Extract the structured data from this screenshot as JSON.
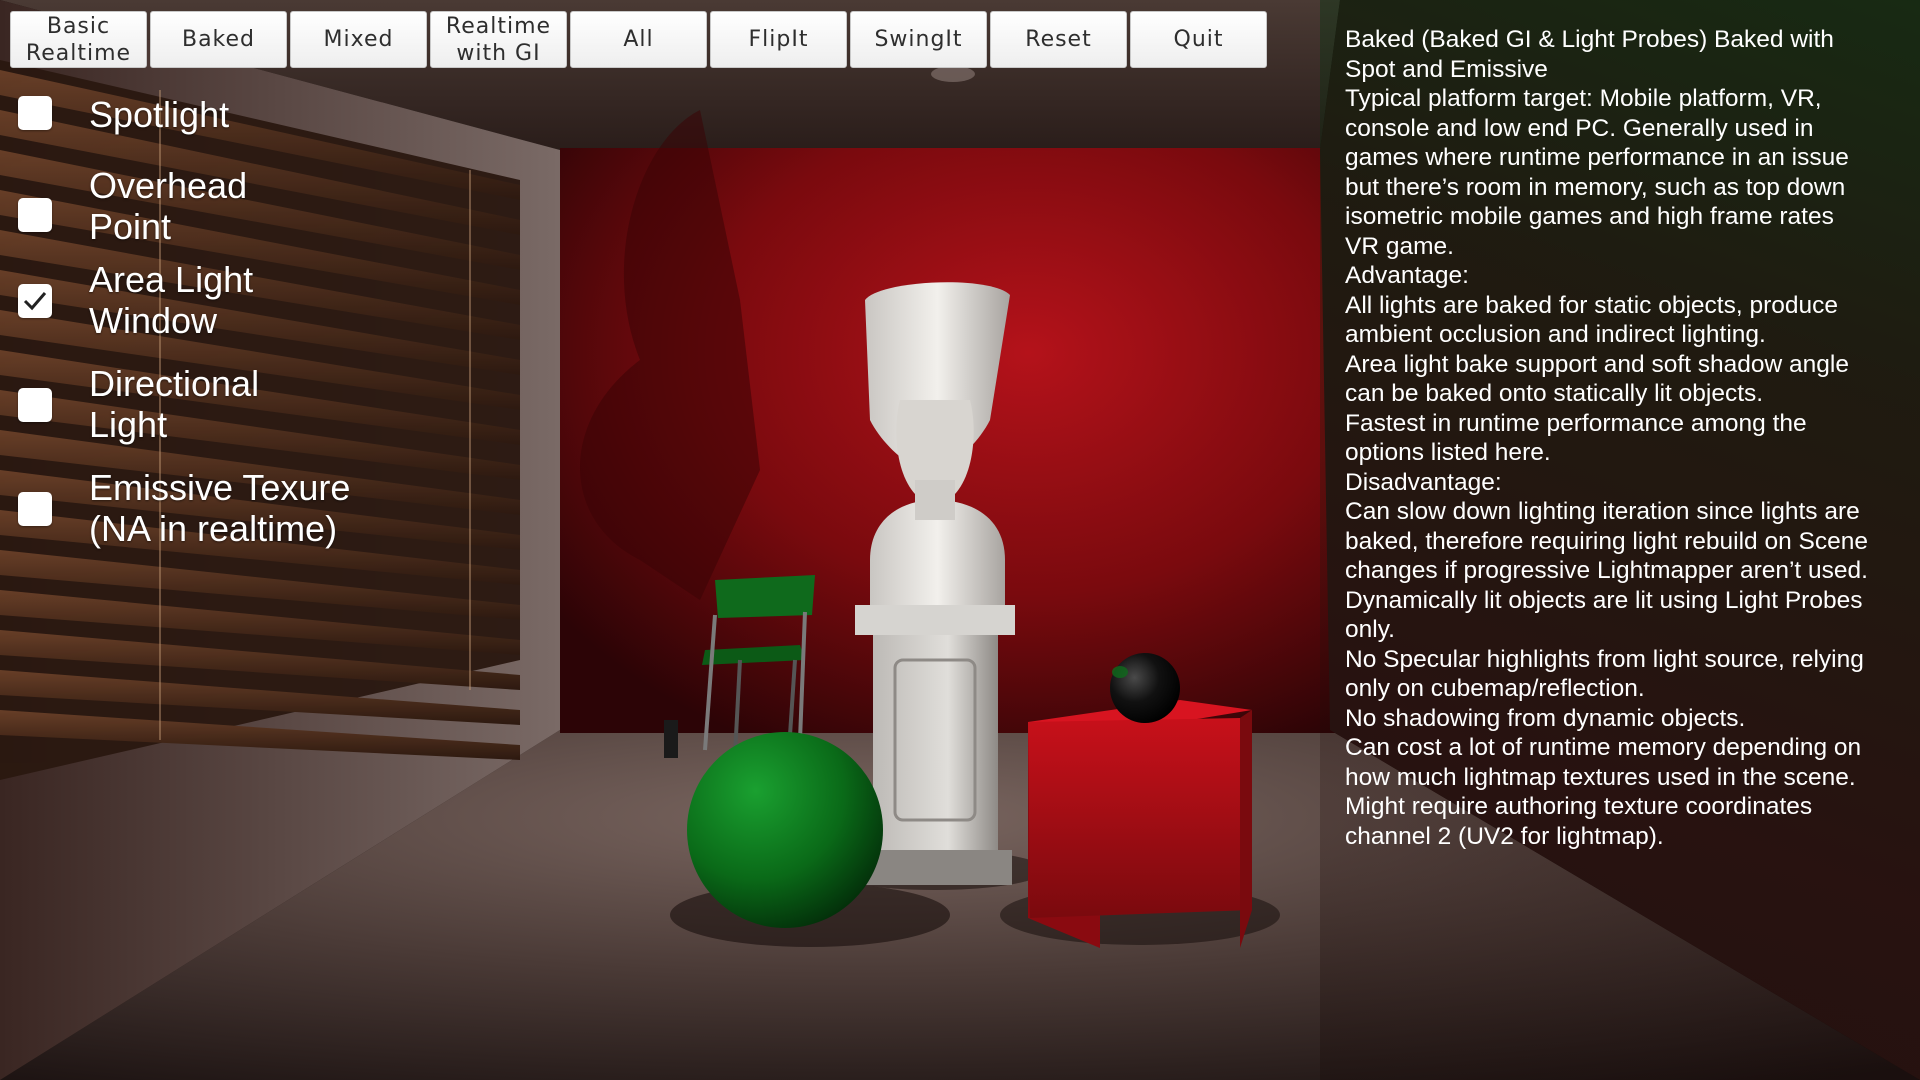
{
  "toolbar": {
    "buttons": [
      {
        "label": "Basic\nRealtime"
      },
      {
        "label": "Baked"
      },
      {
        "label": "Mixed"
      },
      {
        "label": "Realtime\nwith GI"
      },
      {
        "label": "All"
      },
      {
        "label": "FlipIt"
      },
      {
        "label": "SwingIt"
      },
      {
        "label": "Reset"
      },
      {
        "label": "Quit"
      }
    ]
  },
  "toggles": [
    {
      "label": "Spotlight",
      "checked": false
    },
    {
      "label": "Overhead\nPoint",
      "checked": false
    },
    {
      "label": "Area Light\nWindow",
      "checked": true
    },
    {
      "label": "Directional\nLight",
      "checked": false
    },
    {
      "label": "Emissive Texure\n(NA in realtime)",
      "checked": false
    }
  ],
  "description": {
    "lines": [
      "Baked (Baked GI & Light Probes) Baked with",
      "Spot and Emissive",
      "Typical platform target: Mobile platform, VR,",
      "console and low end PC. Generally used in",
      "games where runtime performance in an issue",
      "but there’s room in memory, such as top down",
      "isometric mobile games and high frame rates",
      "VR game.",
      "Advantage:",
      "All lights are baked for static objects, produce",
      "ambient occlusion and indirect lighting.",
      "Area light bake support and soft shadow angle",
      "can be baked onto statically lit objects.",
      "Fastest in runtime performance among the",
      "options listed here.",
      "Disadvantage:",
      "Can slow down lighting iteration since lights are",
      "baked, therefore requiring light rebuild on Scene",
      "changes if progressive Lightmapper aren’t used.",
      "Dynamically lit objects are lit using Light Probes",
      "only.",
      "No Specular highlights from light source, relying",
      "only on cubemap/reflection.",
      "No shadowing from dynamic objects.",
      "Can cost a lot of runtime memory depending on",
      "how much lightmap textures used in the scene.",
      "Might require authoring texture coordinates",
      "channel 2 (UV2 for lightmap)."
    ]
  },
  "scene": {
    "colors": {
      "back_wall": "#8a0c10",
      "floor": "#5a4a44",
      "sphere": "#0d7a1e",
      "cube": "#b30c12",
      "bust": "#e8e6e2",
      "chair": "#0f6a1c",
      "blinds": "#5a3420",
      "panel_tint": "#0a4a16"
    }
  }
}
